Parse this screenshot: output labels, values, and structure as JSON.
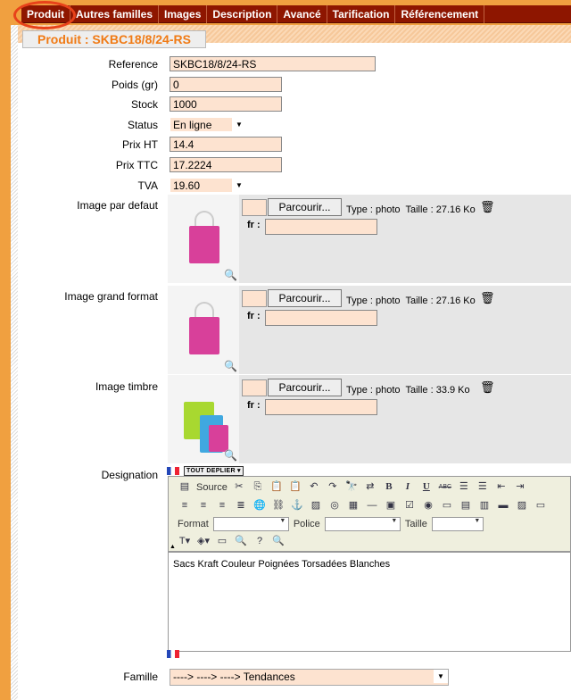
{
  "tabs": [
    "Produit",
    "Autres familles",
    "Images",
    "Description",
    "Avancé",
    "Tarification",
    "Référencement"
  ],
  "title": "Produit : SKBC18/8/24-RS",
  "fields": {
    "reference": {
      "label": "Reference",
      "value": "SKBC18/8/24-RS"
    },
    "poids": {
      "label": "Poids (gr)",
      "value": "0"
    },
    "stock": {
      "label": "Stock",
      "value": "1000"
    },
    "status": {
      "label": "Status",
      "value": "En ligne"
    },
    "prix_ht": {
      "label": "Prix HT",
      "value": "14.4"
    },
    "prix_ttc": {
      "label": "Prix TTC",
      "value": "17.2224"
    },
    "tva": {
      "label": "TVA",
      "value": "19.60"
    }
  },
  "images": [
    {
      "label": "Image par defaut",
      "button": "Parcourir...",
      "type": "Type : photo",
      "size": "Taille : 27.16 Ko",
      "fr": "fr :"
    },
    {
      "label": "Image grand format",
      "button": "Parcourir...",
      "type": "Type : photo",
      "size": "Taille : 27.16 Ko",
      "fr": "fr :"
    },
    {
      "label": "Image timbre",
      "button": "Parcourir...",
      "type": "Type : photo",
      "size": "Taille : 33.9 Ko",
      "fr": "fr :"
    }
  ],
  "designation": {
    "label": "Designation",
    "expand": "TOUT DEPLIER ▾",
    "source": "Source",
    "format": "Format",
    "police": "Police",
    "taille": "Taille",
    "content": "Sacs Kraft Couleur Poignées Torsadées Blanches"
  },
  "famille": {
    "label": "Famille",
    "value": "----> ----> ----> Tendances"
  }
}
